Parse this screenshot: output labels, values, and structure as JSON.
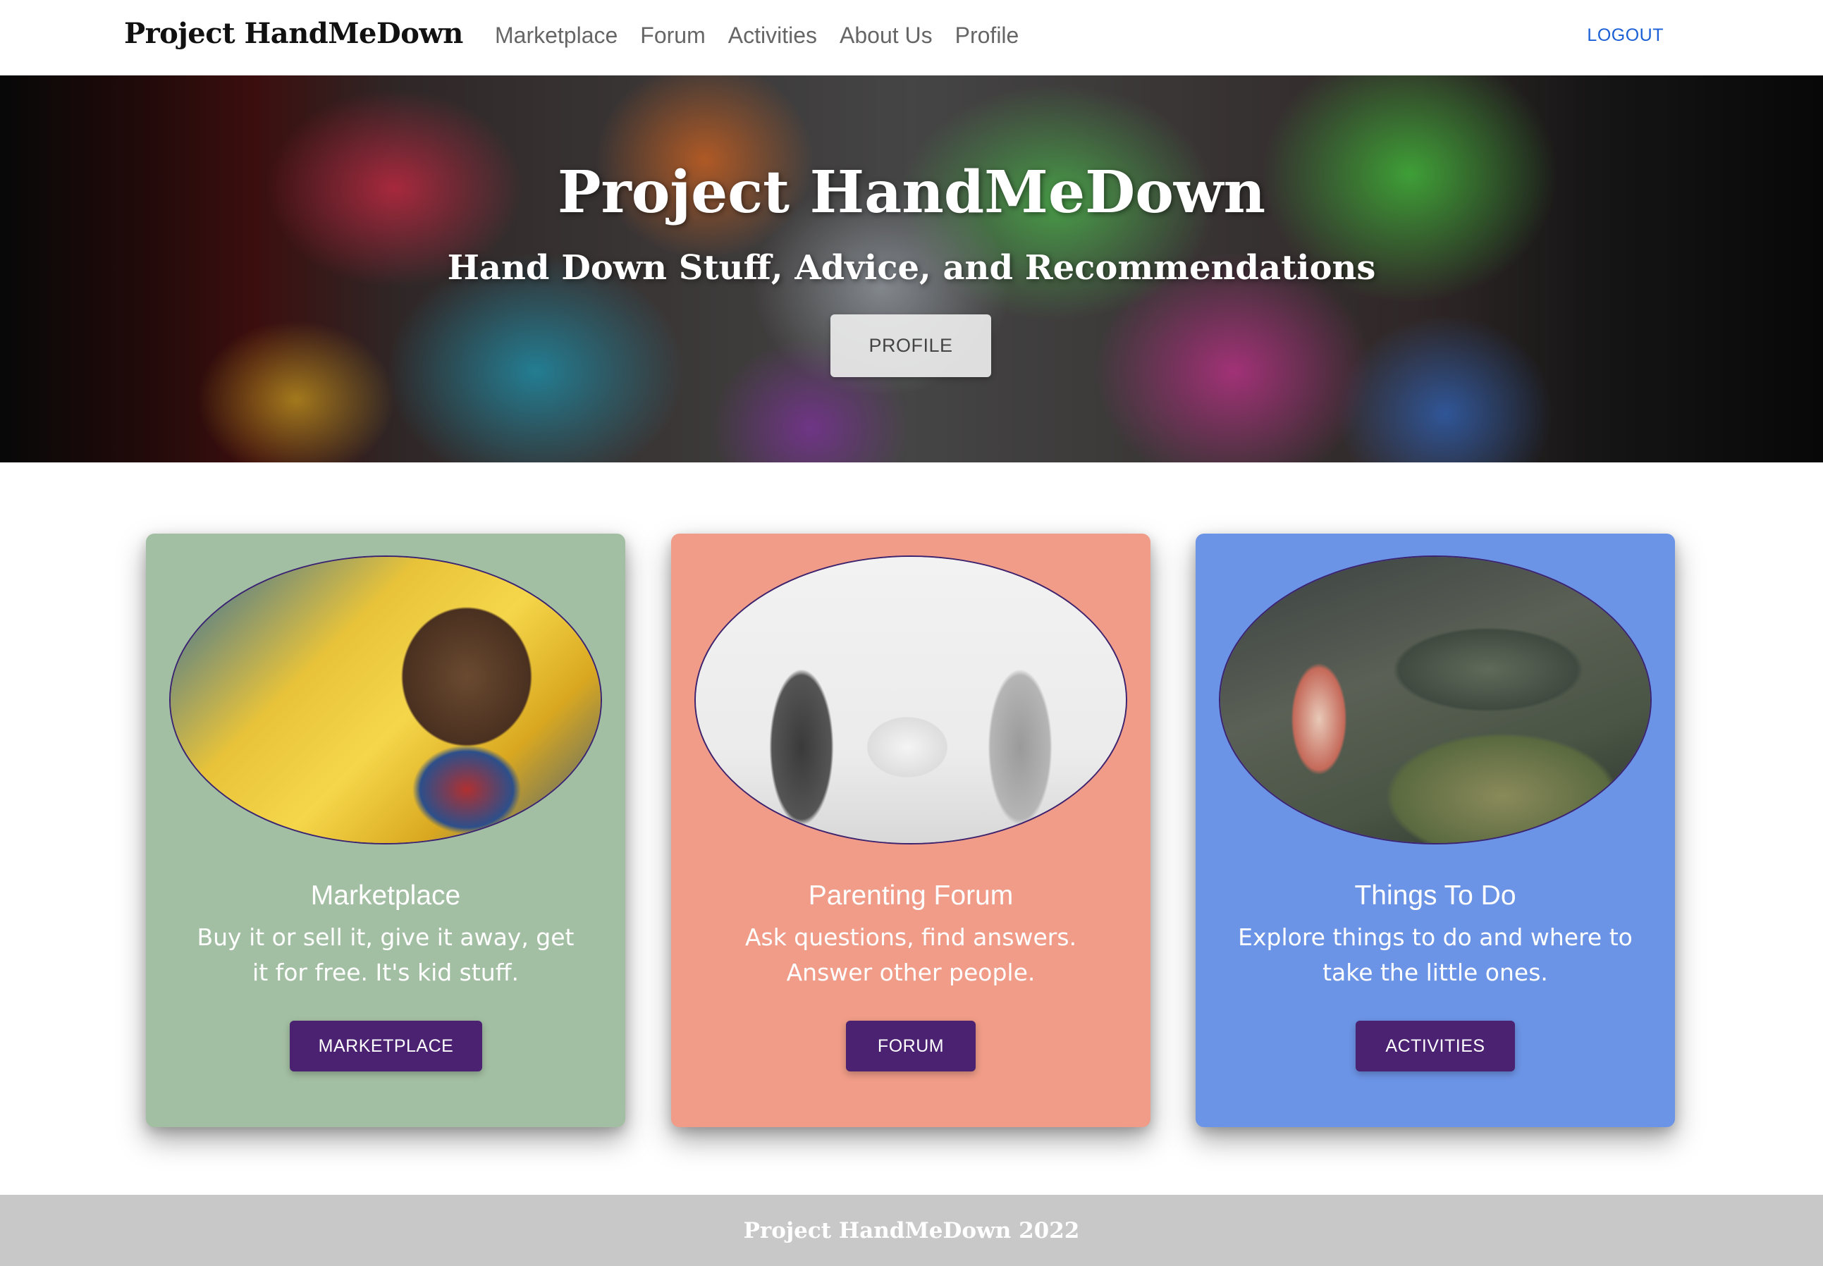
{
  "navbar": {
    "brand": "Project HandMeDown",
    "links": [
      "Marketplace",
      "Forum",
      "Activities",
      "About Us",
      "Profile"
    ],
    "logout": "LOGOUT",
    "logout_color": "#1a5fd6"
  },
  "hero": {
    "title": "Project HandMeDown",
    "subtitle": "Hand Down Stuff, Advice, and Recommendations",
    "button": "PROFILE"
  },
  "cards": [
    {
      "title": "Marketplace",
      "text": "Buy it or sell it, give it away, get it for free. It's kid stuff.",
      "button": "MARKETPLACE",
      "bg_color": "#a3bfa3"
    },
    {
      "title": "Parenting Forum",
      "text": "Ask questions, find answers. Answer other people.",
      "button": "FORUM",
      "bg_color": "#f09c88"
    },
    {
      "title": "Things To Do",
      "text": "Explore things to do and where to take the little ones.",
      "button": "ACTIVITIES",
      "bg_color": "#6c94e6"
    }
  ],
  "button_color": "#4b2171",
  "footer": {
    "text": "Project HandMeDown 2022"
  }
}
